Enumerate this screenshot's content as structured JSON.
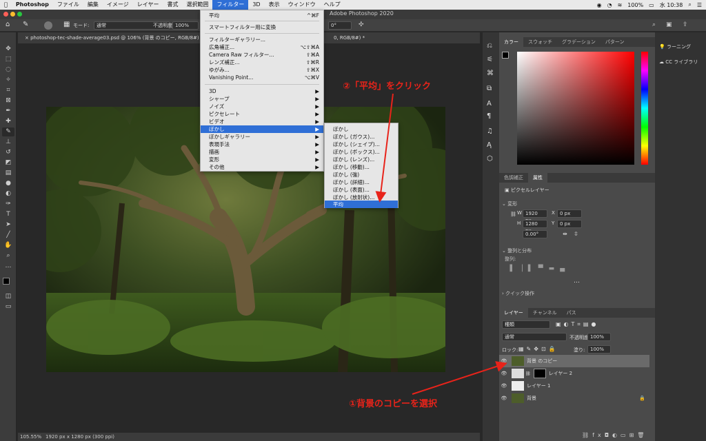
{
  "menubar": {
    "apple": "",
    "app": "Photoshop",
    "items": [
      "ファイル",
      "編集",
      "イメージ",
      "レイヤー",
      "書式",
      "選択範囲",
      "フィルター",
      "3D",
      "表示",
      "ウィンドウ",
      "ヘルプ"
    ],
    "active_index": 6,
    "battery": "100%",
    "clock": "水 10:38"
  },
  "window": {
    "title": "Adobe Photoshop 2020"
  },
  "options": {
    "mode_label": "モード:",
    "mode_value": "通常",
    "opacity_label": "不透明度:",
    "opacity_value": "100%",
    "angle_value": "0°"
  },
  "document_tab": {
    "title": "photoshop-tec-shade-average03.psd @ 106% (背景 のコピー, RGB/8#) *",
    "tail": "0, RGB/8#) *"
  },
  "status": {
    "zoom": "105.55%",
    "info": "1920 px x 1280 px (300 ppi)"
  },
  "filter_menu": {
    "items": [
      {
        "label": "平均",
        "shortcut": "^⌘F"
      },
      {
        "label": "スマートフィルター用に変換",
        "shortcut": ""
      },
      {
        "label": "フィルターギャラリー...",
        "shortcut": ""
      },
      {
        "label": "広角補正...",
        "shortcut": "⌥⇧⌘A"
      },
      {
        "label": "Camera Raw フィルター...",
        "shortcut": "⇧⌘A"
      },
      {
        "label": "レンズ補正...",
        "shortcut": "⇧⌘R"
      },
      {
        "label": "ゆがみ...",
        "shortcut": "⇧⌘X"
      },
      {
        "label": "Vanishing Point...",
        "shortcut": "⌥⌘V"
      },
      {
        "label": "3D",
        "shortcut": "▶"
      },
      {
        "label": "シャープ",
        "shortcut": "▶"
      },
      {
        "label": "ノイズ",
        "shortcut": "▶"
      },
      {
        "label": "ピクセレート",
        "shortcut": "▶"
      },
      {
        "label": "ビデオ",
        "shortcut": "▶"
      },
      {
        "label": "ぼかし",
        "shortcut": "▶"
      },
      {
        "label": "ぼかしギャラリー",
        "shortcut": "▶"
      },
      {
        "label": "表現手法",
        "shortcut": "▶"
      },
      {
        "label": "描画",
        "shortcut": "▶"
      },
      {
        "label": "変形",
        "shortcut": "▶"
      },
      {
        "label": "その他",
        "shortcut": "▶"
      }
    ]
  },
  "blur_submenu": {
    "items": [
      "ぼかし",
      "ぼかし (ガウス)...",
      "ぼかし (シェイプ)...",
      "ぼかし (ボックス)...",
      "ぼかし (レンズ)...",
      "ぼかし (移動)...",
      "ぼかし (強)",
      "ぼかし (詳細)...",
      "ぼかし (表面)...",
      "ぼかし (放射状)...",
      "平均"
    ]
  },
  "annotations": {
    "step2": "②「平均」をクリック",
    "step1": "①背景のコピーを選択"
  },
  "color_panel": {
    "tabs": [
      "カラー",
      "スウォッチ",
      "グラデーション",
      "パターン"
    ]
  },
  "properties_panel": {
    "tabs": [
      "色調補正",
      "属性"
    ],
    "pixel_layer": "ピクセルレイヤー",
    "transform": "変形",
    "w_label": "W",
    "w": "1920 px",
    "x_label": "X",
    "x": "0 px",
    "h_label": "H",
    "h": "1280 px",
    "y_label": "Y",
    "y": "0 px",
    "angle": "0.00°",
    "align": "整列と分布",
    "align_sub": "整列:",
    "quick": "クイック操作"
  },
  "layers_panel": {
    "tabs": [
      "レイヤー",
      "チャンネル",
      "パス"
    ],
    "kind": "種類",
    "blend": "通常",
    "opacity_label": "不透明度:",
    "opacity": "100%",
    "lock_label": "ロック:",
    "fill_label": "塗り:",
    "fill": "100%",
    "layers": [
      {
        "name": "背景 のコピー"
      },
      {
        "name": "レイヤー 2"
      },
      {
        "name": "レイヤー 1"
      },
      {
        "name": "背景"
      }
    ]
  },
  "learn_panel": {
    "items": [
      "ラーニング",
      "CC ライブラリ"
    ]
  },
  "colors": {
    "accent": "#2f6fd6",
    "annotation": "#e8231a"
  }
}
